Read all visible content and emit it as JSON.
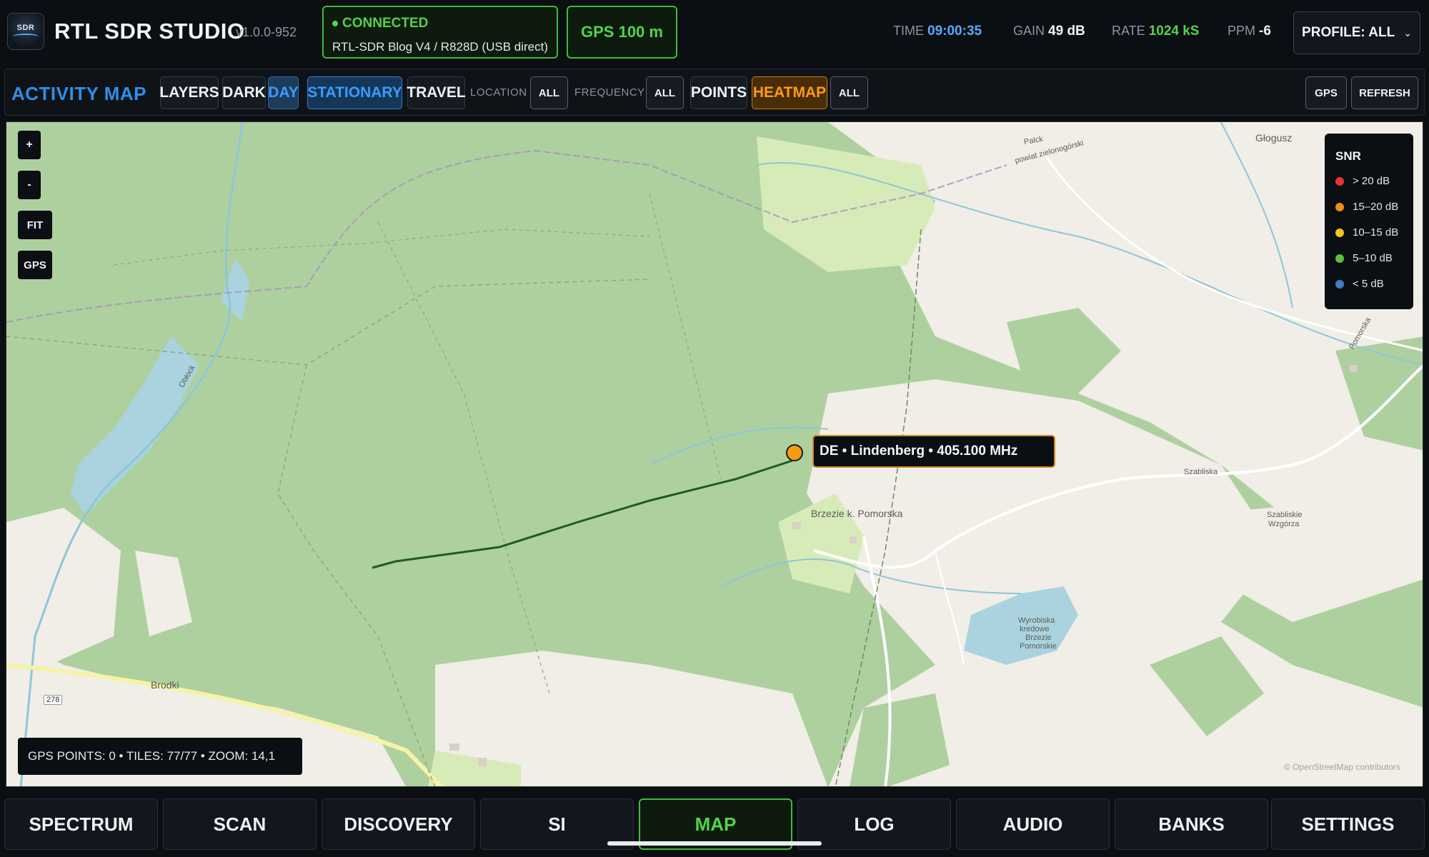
{
  "header": {
    "logo": {
      "icon": "sdr-logo-icon",
      "text": "SDR"
    },
    "title": "RTL SDR STUDIO",
    "version": "v1.0.0-952",
    "connection": {
      "status": "CONNECTED",
      "device": "RTL-SDR Blog V4 / R828D (USB direct)",
      "color": "#52d34a"
    },
    "gps_accuracy": "GPS 100 m",
    "stats": {
      "time_label": "TIME",
      "time_value": "09:00:35",
      "gain_label": "GAIN",
      "gain_value": "49 dB",
      "rate_label": "RATE",
      "rate_value": "1024 kS",
      "ppm_label": "PPM",
      "ppm_value": "-6"
    },
    "profile": {
      "label": "PROFILE: ALL",
      "chevron": "chevron-down-icon"
    }
  },
  "toolbar": {
    "title": "ACTIVITY MAP",
    "layers": "LAYERS",
    "dark": "DARK",
    "day": "DAY",
    "stationary": "STATIONARY",
    "travel": "TRAVEL",
    "location_label": "LOCATION",
    "location_value": "ALL",
    "frequency_label": "FREQUENCY",
    "frequency_value": "ALL",
    "points": "POINTS",
    "heatmap": "HEATMAP",
    "heatmap_value": "ALL",
    "gps": "GPS",
    "refresh": "REFRESH"
  },
  "map": {
    "controls": {
      "zoom_in": "+",
      "zoom_out": "-",
      "fit": "FIT",
      "gps": "GPS"
    },
    "legend": {
      "title": "SNR",
      "items": [
        {
          "label": "> 20 dB",
          "color": "#e5343a"
        },
        {
          "label": "15–20 dB",
          "color": "#f08a1c"
        },
        {
          "label": "10–15 dB",
          "color": "#f3c41c"
        },
        {
          "label": "5–10 dB",
          "color": "#5bbf3c"
        },
        {
          "label": "< 5 dB",
          "color": "#3f7fc4"
        }
      ]
    },
    "marker": {
      "label": "DE • Lindenberg  •  405.100 MHz",
      "color": "#f39c12"
    },
    "status": "GPS POINTS: 0  •  TILES: 77/77  •  ZOOM: 14,1",
    "attribution": "© OpenStreetMap contributors",
    "places": {
      "brzezie": "Brzezie k. Pomorska",
      "brodki": "Brodki",
      "szabliska": "Szabliska",
      "szabliskie": "Szabliskie",
      "wzgorza": "Wzgórza",
      "glogusz": "Głogusz",
      "oblock": "Obłock",
      "pomorska": "Pomorska",
      "palck": "Palck",
      "powiat": "powiat zielonogórski",
      "wyrobiska1": "Wyrobiska",
      "wyrobiska2": "kredowe",
      "wyrobiska3": "Brzezie",
      "wyrobiska4": "Pomorskie",
      "road_278": "278"
    }
  },
  "nav": {
    "tabs": [
      "SPECTRUM",
      "SCAN",
      "DISCOVERY",
      "SI",
      "MAP",
      "LOG",
      "AUDIO",
      "BANKS",
      "SETTINGS"
    ],
    "active": "MAP"
  }
}
